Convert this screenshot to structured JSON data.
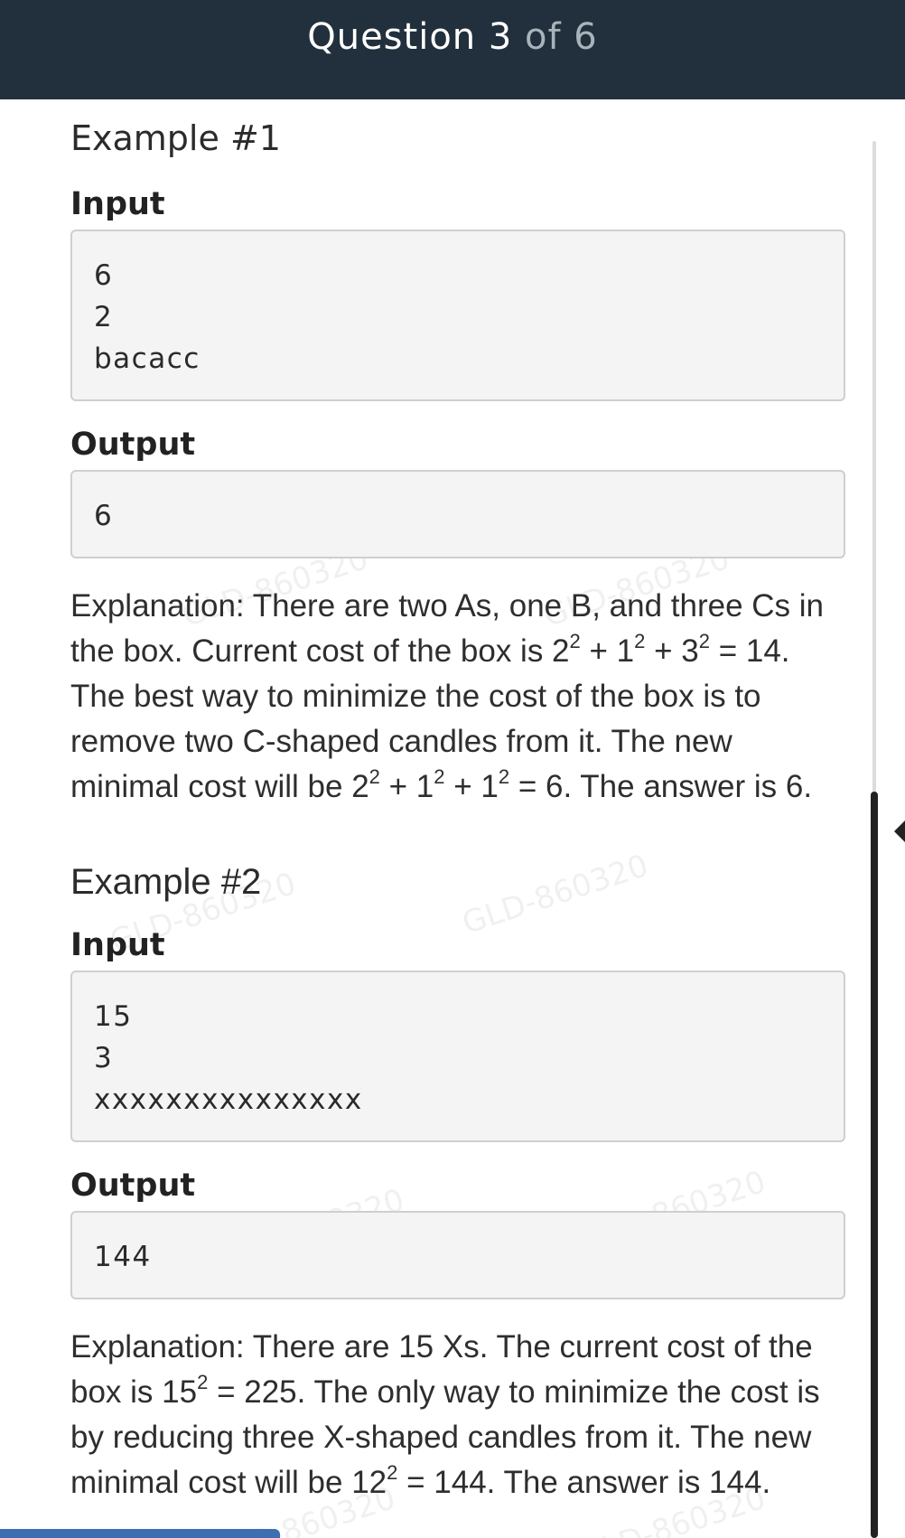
{
  "header": {
    "question_word": "Question",
    "question_number": "3",
    "of_text": "of 6"
  },
  "example1": {
    "heading": "Example #1",
    "input_label": "Input",
    "input_lines": [
      "6",
      "2",
      "bacacc"
    ],
    "output_label": "Output",
    "output_lines": [
      "6"
    ],
    "explanation": {
      "p1": "Explanation: There are two As, one B, and three Cs in the box. Current cost of the box is 2",
      "p2": " + 1",
      "p3": " + 3",
      "p4": " = 14. The best way to minimize the cost of the box is to remove two C-shaped candles from it. The new minimal cost will be 2",
      "p5": " + 1",
      "p6": " + 1",
      "p7": " = 6. The answer is 6.",
      "sup": "2"
    }
  },
  "example2": {
    "heading": "Example #2",
    "input_label": "Input",
    "input_lines": [
      "15",
      "3",
      "xxxxxxxxxxxxxxx"
    ],
    "output_label": "Output",
    "output_lines": [
      "144"
    ],
    "explanation": {
      "p1": "Explanation: There are 15 Xs. The current cost of the box is 15",
      "p2": " = 225. The only way to minimize the cost is by reducing three X-shaped candles from it. The new minimal cost will be 12",
      "p3": " = 144. The answer is 144.",
      "sup": "2"
    }
  },
  "watermark": "GLD-860320"
}
